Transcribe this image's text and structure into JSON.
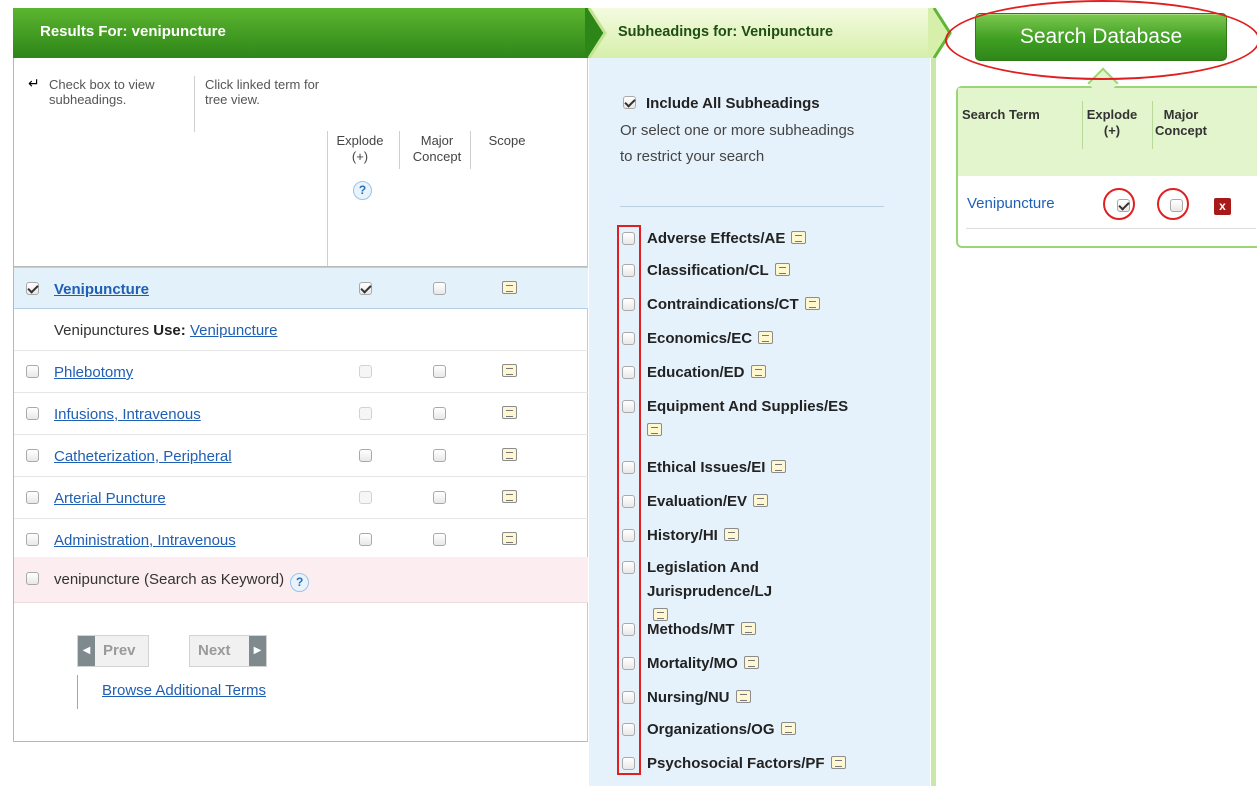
{
  "header": {
    "results_title": "Results For: venipuncture",
    "subheadings_title": "Subheadings for: Venipuncture"
  },
  "instructions": {
    "check_box": "Check box to view subheadings.",
    "click_link": "Click linked term for tree view."
  },
  "columns": {
    "explode": "Explode (+)",
    "major": "Major Concept",
    "scope": "Scope",
    "help_glyph": "?"
  },
  "results": {
    "selected_term": "Venipuncture",
    "use_prefix": "Venipunctures",
    "use_label": "Use:",
    "use_link": "Venipuncture",
    "rows": [
      {
        "label": "Phlebotomy"
      },
      {
        "label": "Infusions, Intravenous"
      },
      {
        "label": "Catheterization, Peripheral"
      },
      {
        "label": "Arterial Puncture"
      },
      {
        "label": "Administration, Intravenous"
      }
    ],
    "keyword_row": "venipuncture (Search as Keyword)"
  },
  "pager": {
    "prev": "Prev",
    "next": "Next",
    "browse": "Browse Additional Terms"
  },
  "subheadings": {
    "include_all": "Include All Subheadings",
    "help_text": "Or select one or more subheadings to restrict your search",
    "items": [
      "Adverse Effects/AE",
      "Classification/CL",
      "Contraindications/CT",
      "Economics/EC",
      "Education/ED",
      "Equipment And Supplies/ES",
      "Ethical Issues/EI",
      "Evaluation/EV",
      "History/HI",
      "Legislation And Jurisprudence/LJ",
      "Methods/MT",
      "Mortality/MO",
      "Nursing/NU",
      "Organizations/OG",
      "Psychosocial Factors/PF"
    ]
  },
  "search_panel": {
    "button": "Search Database",
    "col_term": "Search Term",
    "col_explode": "Explode (+)",
    "col_major": "Major Concept",
    "term": "Venipuncture",
    "remove_glyph": "x"
  },
  "colors": {
    "header_green": "#2d8618",
    "link_blue": "#1f5fb4",
    "annotation_red": "#e02020"
  },
  "icons": [
    "check-box-icon",
    "scope-note-icon",
    "help-icon",
    "remove-icon",
    "prev-arrow-icon",
    "next-arrow-icon"
  ]
}
